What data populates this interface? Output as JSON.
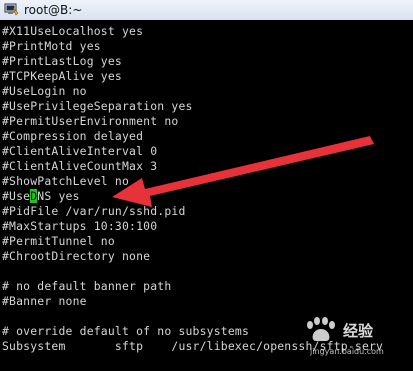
{
  "window": {
    "title": "root@B:~"
  },
  "terminal": {
    "lines": [
      "#X11UseLocalhost yes",
      "#PrintMotd yes",
      "#PrintLastLog yes",
      "#TCPKeepAlive yes",
      "#UseLogin no",
      "#UsePrivilegeSeparation yes",
      "#PermitUserEnvironment no",
      "#Compression delayed",
      "#ClientAliveInterval 0",
      "#ClientAliveCountMax 3",
      "#ShowPatchLevel no",
      "#UseDNS yes",
      "#PidFile /var/run/sshd.pid",
      "#MaxStartups 10:30:100",
      "#PermitTunnel no",
      "#ChrootDirectory none",
      "",
      "# no default banner path",
      "#Banner none",
      "",
      "# override default of no subsystems",
      "Subsystem       sftp    /usr/libexec/openssh/sftp-serv"
    ],
    "usedns_line": {
      "prefix": "#Use",
      "cursor_char": "D",
      "suffix": "NS yes"
    },
    "cursor_color": "#22c61f",
    "arrow_color": "#e8323a"
  },
  "watermark": {
    "brand": "Baidu",
    "text": "经验",
    "url": "jingyan.baidu.com"
  }
}
